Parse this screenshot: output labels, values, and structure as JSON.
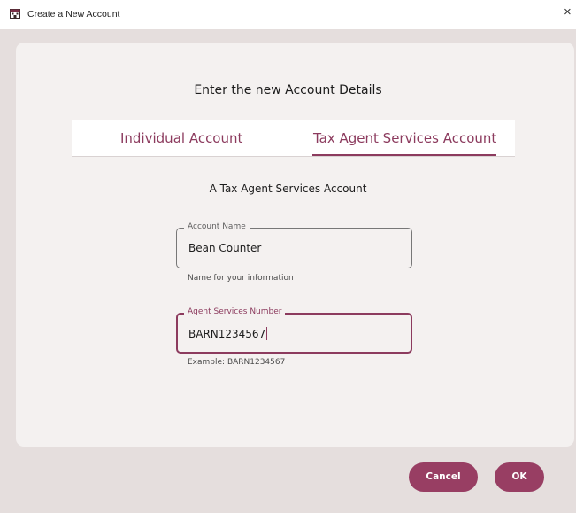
{
  "window": {
    "title": "Create a New Account",
    "close_glyph": "×",
    "icon": "calendar-building-icon"
  },
  "dialog": {
    "heading": "Enter the new Account Details",
    "tabs": [
      {
        "label": "Individual Account",
        "selected": false
      },
      {
        "label": "Tax Agent Services Account",
        "selected": true
      }
    ],
    "subtitle": "A Tax Agent Services Account",
    "fields": {
      "account_name": {
        "label": "Account Name",
        "value": "Bean Counter",
        "helper": "Name for your information"
      },
      "agent_number": {
        "label": "Agent Services Number",
        "value": "BARN1234567",
        "helper": "Example: BARN1234567",
        "focused": true
      }
    }
  },
  "buttons": {
    "cancel": "Cancel",
    "ok": "OK"
  },
  "colors": {
    "accent": "#8c3b5e",
    "button_fill": "#983e63",
    "background": "#e5dedd",
    "card": "#f4f1f0"
  }
}
